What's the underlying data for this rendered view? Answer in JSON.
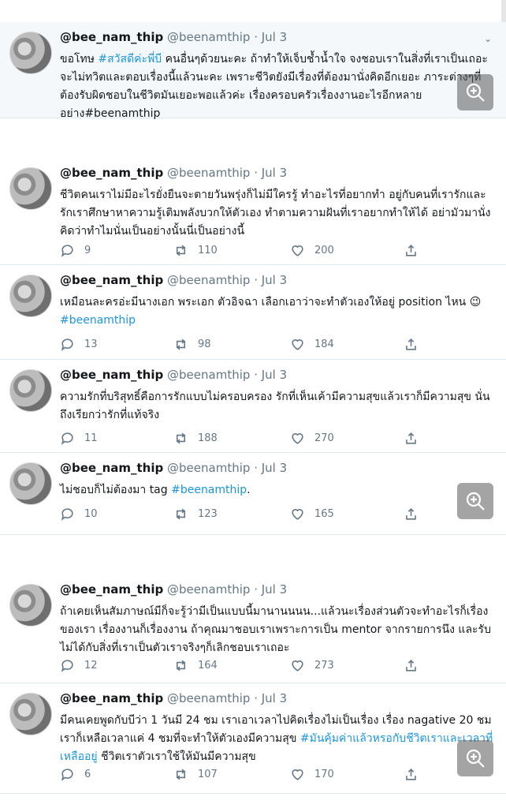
{
  "tweets": [
    {
      "name": "@bee_nam_thip",
      "handle": "@beenamthip",
      "date": "Jul 3",
      "parts": [
        {
          "t": "ขอโทษ "
        },
        {
          "t": "#สวัสดีค่ะพี่บี",
          "tag": true
        },
        {
          "t": " คนอื่นๆด้วยนะคะ ถ้าทำให้เจ็บช้ำน้ำใจ จงชอบเราในสิ่งที่เราเป็นเถอะ จะไม่ทวิตและตอบเรื่องนี้แล้วนะคะ เพราะชีวิตยังมีเรื่องที่ต้องมานั่งคิดอีกเยอะ ภาระต่างๆที่ต้องรับผิดชอบในชีวิตมันเยอะพอแล้วค่ะ เรื่องครอบครัวเรื่องงานอะไรอีกหลายอย่าง"
        },
        {
          "t": "#beenamthip"
        }
      ],
      "stats": null
    },
    {
      "name": "@bee_nam_thip",
      "handle": "@beenamthip",
      "date": "Jul 3",
      "parts": [
        {
          "t": "ชีวิตคนเราไม่มีอะไรยั่งยืนจะตายวันพรุ่งก็ไม่มีใครรู้ ทำอะไรที่อยากทำ อยู่กับคนที่เรารักและรักเราศึกษาหาความรู้เติมพลังบวกให้ตัวเอง ทำตามความฝันที่เราอยากทำให้ได้ อย่ามัวมานั่งคิดว่าทำไมนั่นเป็นอย่างนั้นนี่เป็นอย่างนี้"
        }
      ],
      "stats": {
        "replies": "9",
        "retweets": "110",
        "likes": "200"
      }
    },
    {
      "name": "@bee_nam_thip",
      "handle": "@beenamthip",
      "date": "Jul 3",
      "parts": [
        {
          "t": "เหมือนละครอ่ะมีนางเอก พระเอก ตัวอิจฉา เลือกเอาว่าจะทำตัวเองให้อยู่ position ไหน 😉 "
        },
        {
          "t": "#beenamthip",
          "tag": true
        }
      ],
      "stats": {
        "replies": "13",
        "retweets": "98",
        "likes": "184"
      }
    },
    {
      "name": "@bee_nam_thip",
      "handle": "@beenamthip",
      "date": "Jul 3",
      "parts": [
        {
          "t": "ความรักที่บริสุทธิ์คือการรักแบบไม่ครอบครอง รักที่เห็นเค้ามีความสุขแล้วเราก็มีความสุข นั่นถึงเรียกว่ารักที่แท้จริง"
        }
      ],
      "stats": {
        "replies": "11",
        "retweets": "188",
        "likes": "270"
      }
    },
    {
      "name": "@bee_nam_thip",
      "handle": "@beenamthip",
      "date": "Jul 3",
      "parts": [
        {
          "t": "ไม่ชอบก็ไม่ต้องมา tag "
        },
        {
          "t": "#beenamthip",
          "tag": true
        },
        {
          "t": "."
        }
      ],
      "stats": {
        "replies": "10",
        "retweets": "123",
        "likes": "165"
      }
    },
    {
      "name": "@bee_nam_thip",
      "handle": "@beenamthip",
      "date": "Jul 3",
      "parts": [
        {
          "t": "ถ้าเคยเห็นสัมภาษณ์มีก็จะรู้ว่ามีเป็นแบบนี้มานานนนน...แล้วนะเรื่องส่วนตัวจะทำอะไรก็เรื่องของเรา เรื่องงานก็เรื่องงาน ถ้าคุณมาชอบเราเพราะการเป็น mentor จากรายการนึง และรับไม่ได้กับสิ่งที่เราเป็นตัวเราจริงๆก็เลิกชอบเราเถอะ"
        }
      ],
      "stats": {
        "replies": "12",
        "retweets": "164",
        "likes": "273"
      }
    },
    {
      "name": "@bee_nam_thip",
      "handle": "@beenamthip",
      "date": "Jul 3",
      "parts": [
        {
          "t": "มีคนเคยพูดกับบีว่า 1 วันมี 24 ชม เราเอาเวลาไปคิดเรื่องไม่เป็นเรื่อง เรื่อง nagative 20 ชม เราก็เหลือเวลาแค่ 4 ชมที่จะทำให้ตัวเองมีความสุข "
        },
        {
          "t": "#มันคุ้มค่าแล้วหรอกับชีวิตเราและเวลาที่เหลืออยู่",
          "tag": true
        },
        {
          "t": " ชีวิตเราตัวเราใช้ให้มันมีความสุข"
        }
      ],
      "stats": {
        "replies": "6",
        "retweets": "107",
        "likes": "170"
      }
    }
  ]
}
